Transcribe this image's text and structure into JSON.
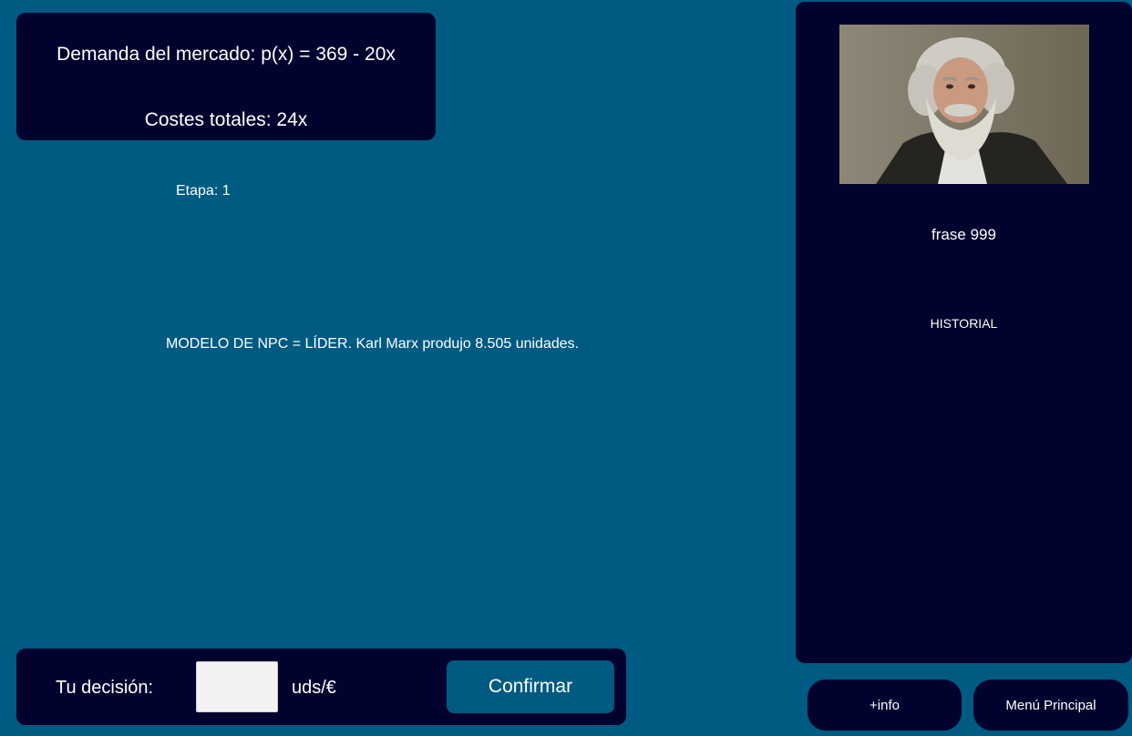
{
  "market": {
    "demand": "Demanda del mercado: p(x) = 369 - 20x",
    "costs": "Costes totales: 24x"
  },
  "stage": "Etapa: 1",
  "npc_message": "MODELO DE NPC = LÍDER. Karl Marx produjo 8.505 unidades.",
  "decision": {
    "label": "Tu decisión:",
    "value": "",
    "unit": "uds/€",
    "confirm_label": "Confirmar"
  },
  "side_panel": {
    "portrait_icon": "npc-portrait-karl-marx",
    "quote": "frase 999",
    "history_title": "HISTORIAL"
  },
  "buttons": {
    "info_label": "+info",
    "menu_label": "Menú Principal"
  },
  "colors": {
    "background": "#005a82",
    "panel": "#02022e",
    "accent": "#005a82"
  }
}
